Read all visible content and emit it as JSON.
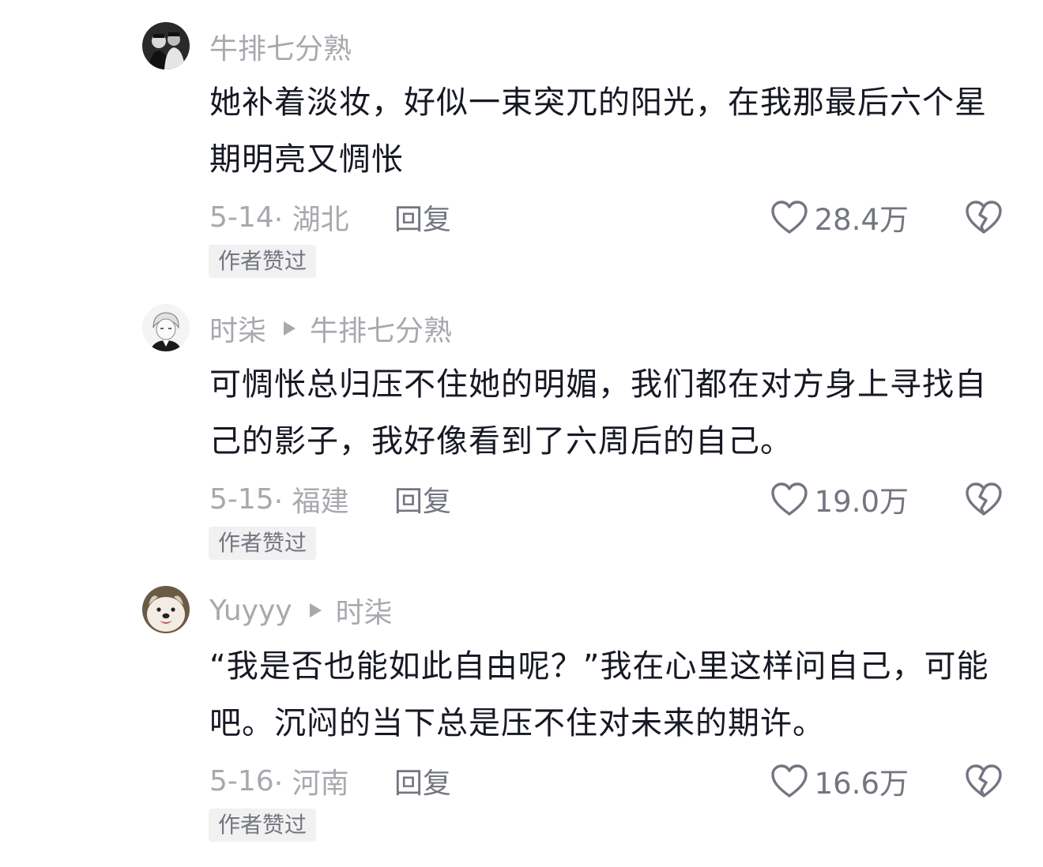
{
  "comments": [
    {
      "author": "牛排七分熟",
      "reply_to": "",
      "text": "她补着淡妆，好似一束突兀的阳光，在我那最后六个星期明亮又惆怅",
      "date": "5-14",
      "location": "· 湖北",
      "reply_label": "回复",
      "likes": "28.4万",
      "badge": "作者赞过",
      "avatar_icon": "avatar-two-men-photo"
    },
    {
      "author": "时柒",
      "reply_to": "牛排七分熟",
      "text": "可惆怅总归压不住她的明媚，我们都在对方身上寻找自己的影子，我好像看到了六周后的自己。",
      "date": "5-15",
      "location": "· 福建",
      "reply_label": "回复",
      "likes": "19.0万",
      "badge": "作者赞过",
      "avatar_icon": "avatar-anime-sketch"
    },
    {
      "author": "Yuyyy",
      "reply_to": "时柒",
      "text": "“我是否也能如此自由呢？”我在心里这样问自己，可能吧。沉闷的当下总是压不住对未来的期许。",
      "date": "5-16",
      "location": "· 河南",
      "reply_label": "回复",
      "likes": "16.6万",
      "badge": "作者赞过",
      "avatar_icon": "avatar-dog-photo"
    }
  ],
  "colors": {
    "text": "#161823",
    "muted": "#a7a9ae",
    "secondary": "#737680",
    "badge_bg": "#f1f1f2"
  }
}
